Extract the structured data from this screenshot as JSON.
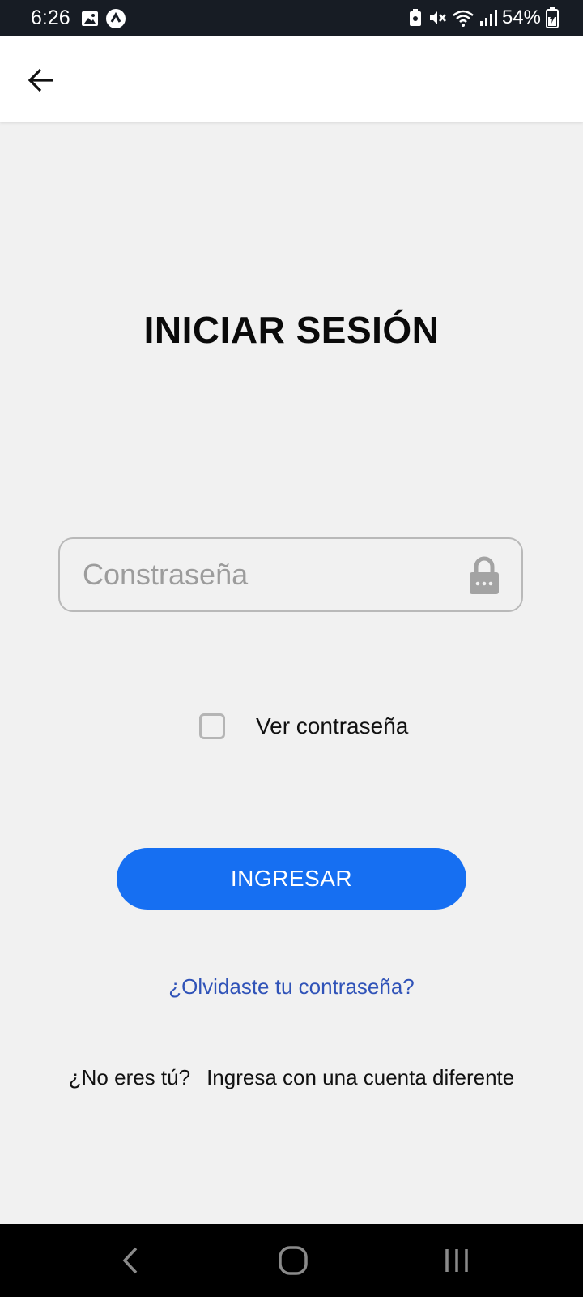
{
  "status_bar": {
    "time": "6:26",
    "battery": "54%",
    "left_icons": [
      "image-icon",
      "app-notification-icon"
    ],
    "right_icons": [
      "battery-saver-icon",
      "mute-icon",
      "wifi-icon",
      "signal-icon",
      "battery-icon"
    ]
  },
  "app_bar": {
    "back_icon": "back-arrow-icon"
  },
  "login": {
    "title": "INICIAR SESIÓN",
    "password_placeholder": "Constraseña",
    "password_value": "",
    "show_password_label": "Ver contraseña",
    "show_password_checked": false,
    "submit_label": "INGRESAR",
    "forgot_link": "¿Olvidaste tu contraseña?",
    "not_you_question": "¿No eres tú?",
    "switch_account_link": "Ingresa con una cuenta diferente"
  },
  "nav_bar": {
    "icons": [
      "back-nav-icon",
      "home-nav-icon",
      "recents-nav-icon"
    ]
  },
  "colors": {
    "status_bar_bg": "#171c24",
    "app_bar_bg": "#ffffff",
    "page_bg": "#f1f1f1",
    "primary_button": "#166ff2",
    "link": "#3053b8",
    "nav_bar_bg": "#000000"
  }
}
